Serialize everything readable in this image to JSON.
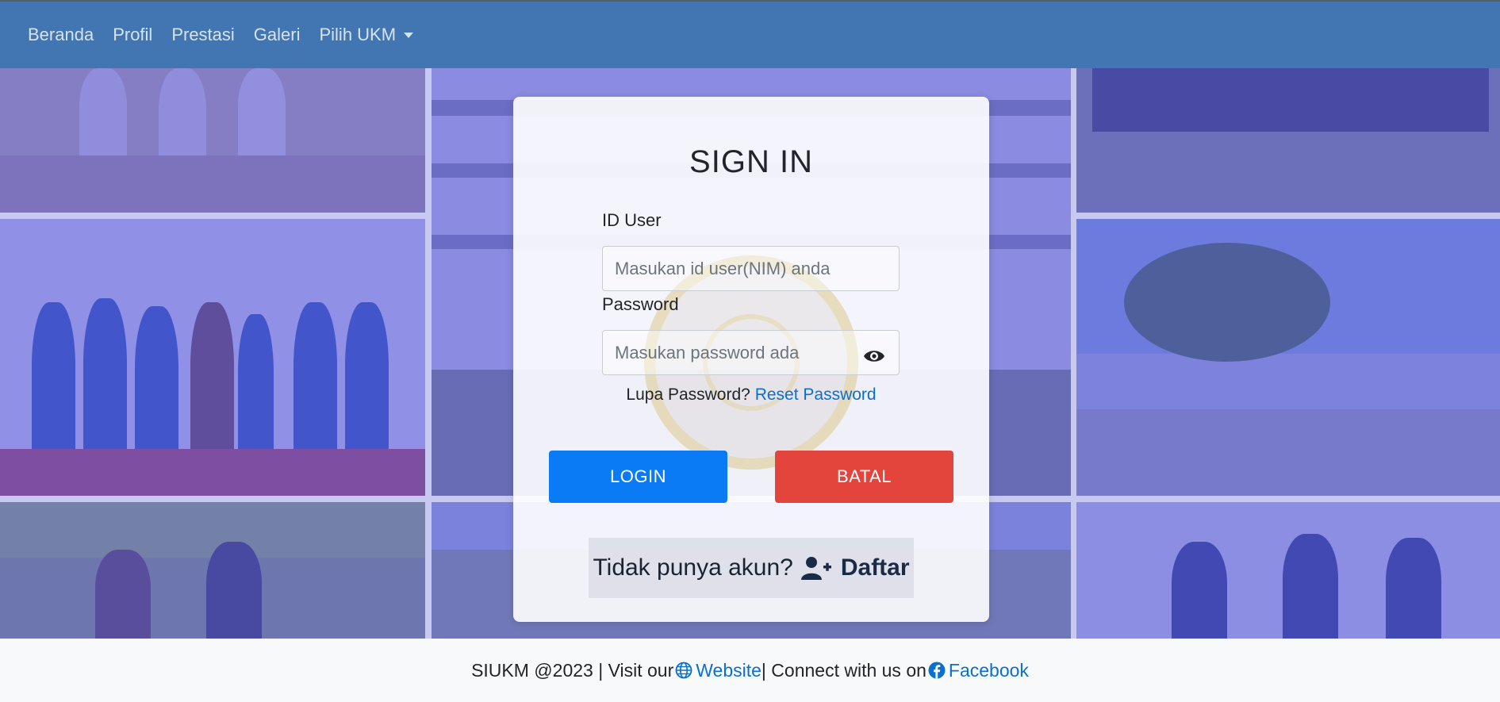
{
  "nav": {
    "items": [
      "Beranda",
      "Profil",
      "Prestasi",
      "Galeri"
    ],
    "dropdown_label": "Pilih UKM"
  },
  "login": {
    "title": "SIGN IN",
    "user_label": "ID User",
    "user_placeholder": "Masukan id user(NIM) anda",
    "password_label": "Password",
    "password_placeholder": "Masukan password ada",
    "password_toggle_icon": "eye-icon",
    "forgot_text": "Lupa Password?",
    "reset_link": "Reset Password",
    "login_button": "LOGIN",
    "cancel_button": "BATAL",
    "register_prompt": "Tidak punya akun?",
    "register_icon": "user-plus-icon",
    "register_link": "Daftar"
  },
  "footer": {
    "copyright": "SIUKM @2023 | Visit our",
    "website_link": "Website",
    "connect_text": "| Connect with us on",
    "facebook_link": "Facebook",
    "website_icon": "globe-icon",
    "facebook_icon": "facebook-icon"
  },
  "colors": {
    "navbar": "#4176b2",
    "login_button": "#0b7bf5",
    "cancel_button": "#e3443b",
    "link": "#0b6fd0",
    "overlay": "#585ae1"
  }
}
